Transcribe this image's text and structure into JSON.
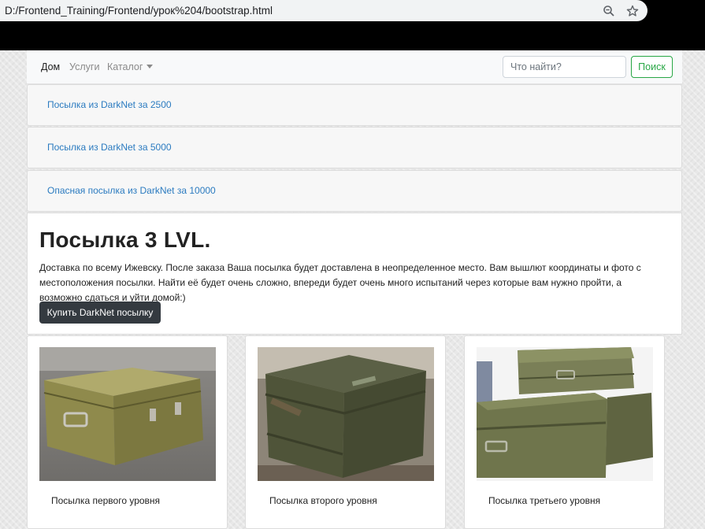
{
  "browser": {
    "url": "D:/Frontend_Training/Frontend/урок%204/bootstrap.html",
    "zoom_icon": "zoom-icon",
    "bookmark_icon": "star-icon"
  },
  "navbar": {
    "items": [
      {
        "label": "Дом",
        "active": true
      },
      {
        "label": "Услуги",
        "active": false
      },
      {
        "label": "Каталог",
        "active": false
      }
    ],
    "search_placeholder": "Что найти?",
    "search_button": "Поиск"
  },
  "links": [
    "Посылка из DarkNet за 2500",
    "Посылка из DarkNet за 5000",
    "Опасная посылка из DarkNet за 10000"
  ],
  "hero": {
    "title": "Посылка 3 LVL.",
    "text": "Доставка по всему Ижевску. После заказа Ваша посылка будет доставлена в неопределенное место. Вам вышлют координаты и фото с местоположения посылки. Найти её будет очень сложно, впереди будет очень много испытаний через которые вам нужно пройти, а возможно сдаться и уйти домой:)",
    "button": "Купить DarkNet посылку"
  },
  "cards": [
    {
      "title": "Посылка первого уровня"
    },
    {
      "title": "Посылка второго уровня"
    },
    {
      "title": "Посылка третьего уровня"
    }
  ],
  "colors": {
    "link": "#2b7bc0",
    "success": "#28a745",
    "dark_button": "#343a40"
  }
}
